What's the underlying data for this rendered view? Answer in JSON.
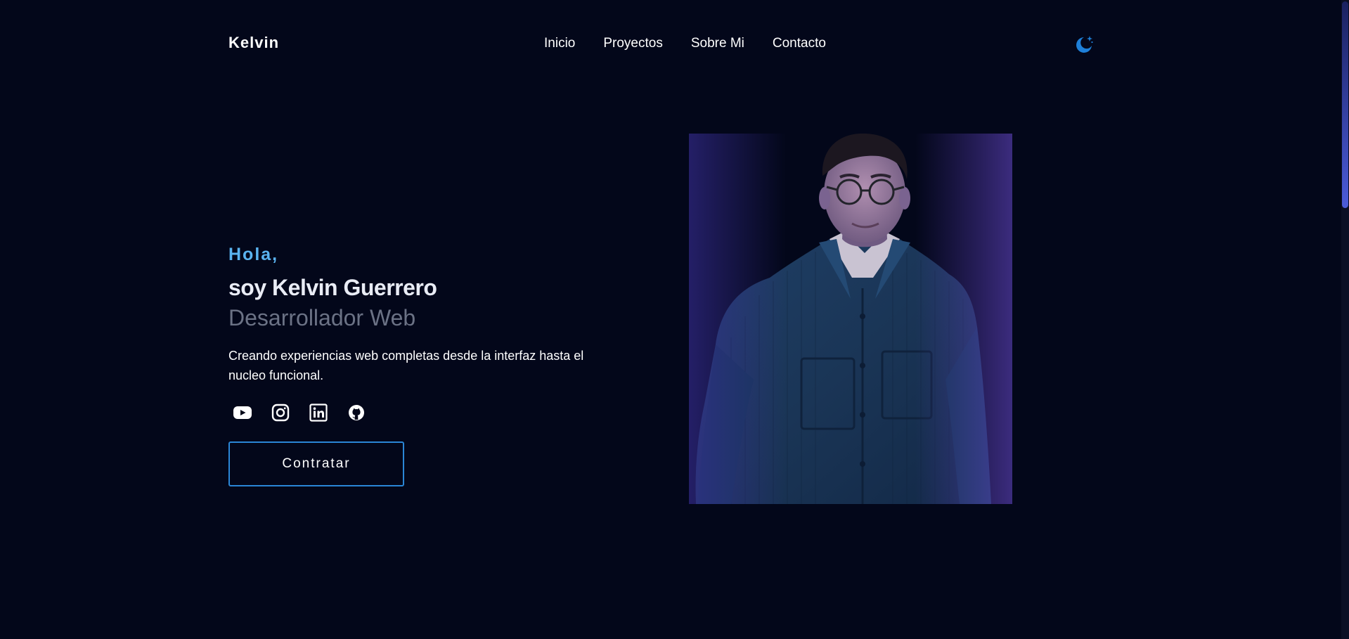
{
  "brand": "Kelvin",
  "nav": {
    "items": [
      "Inicio",
      "Proyectos",
      "Sobre Mi",
      "Contacto"
    ]
  },
  "theme_toggle": {
    "icon": "moon-star-icon",
    "color": "#1e7fd8"
  },
  "hero": {
    "greeting": "Hola,",
    "name": "soy Kelvin Guerrero",
    "role": "Desarrollador Web",
    "tagline": "Creando experiencias web completas desde la interfaz hasta el nucleo funcional.",
    "socials": [
      {
        "icon": "youtube-icon"
      },
      {
        "icon": "instagram-icon"
      },
      {
        "icon": "linkedin-icon"
      },
      {
        "icon": "github-icon"
      }
    ],
    "cta_label": "Contratar",
    "accent_color": "#5ab3f0",
    "button_border_color": "#2a86d6"
  },
  "colors": {
    "background": "#03071a",
    "text": "#ffffff",
    "muted": "#6b7285"
  }
}
